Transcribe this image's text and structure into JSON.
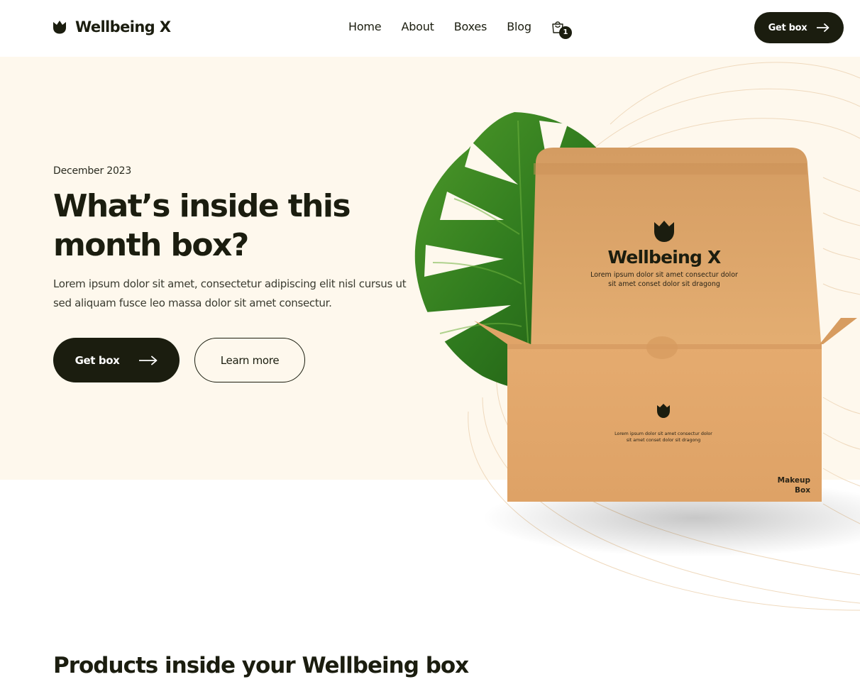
{
  "brand": {
    "name": "Wellbeing X",
    "logo_icon": "tulip-icon"
  },
  "nav": {
    "items": [
      {
        "label": "Home"
      },
      {
        "label": "About"
      },
      {
        "label": "Boxes"
      },
      {
        "label": "Blog"
      }
    ],
    "cart": {
      "icon": "shopping-bag-icon",
      "count": "1"
    },
    "cta_label": "Get box"
  },
  "hero": {
    "eyebrow": "December 2023",
    "title": "What’s inside this month box?",
    "description": "Lorem ipsum dolor sit amet, consectetur adipiscing elit nisl cursus ut sed aliquam fusce leo massa dolor sit amet consectur.",
    "primary_button": "Get box",
    "secondary_button": "Learn more",
    "image": {
      "box_brand": "Wellbeing X",
      "lid_text_line1": "Lorem ipsum dolor sit amet consectur dolor",
      "lid_text_line2": "sit amet conset dolor sit dragong",
      "front_text_line1": "Lorem ipsum dolor sit amet consectur dolor",
      "front_text_line2": "sit amet conset dolor sit dragong",
      "box_label_line1": "Makeup",
      "box_label_line2": "Box"
    }
  },
  "products_section": {
    "title": "Products inside your Wellbeing box"
  },
  "colors": {
    "dark": "#1b1d0f",
    "hero_background": "#fef8ed",
    "cardboard": "#e2a86c",
    "leaf": "#2f7a1e"
  }
}
